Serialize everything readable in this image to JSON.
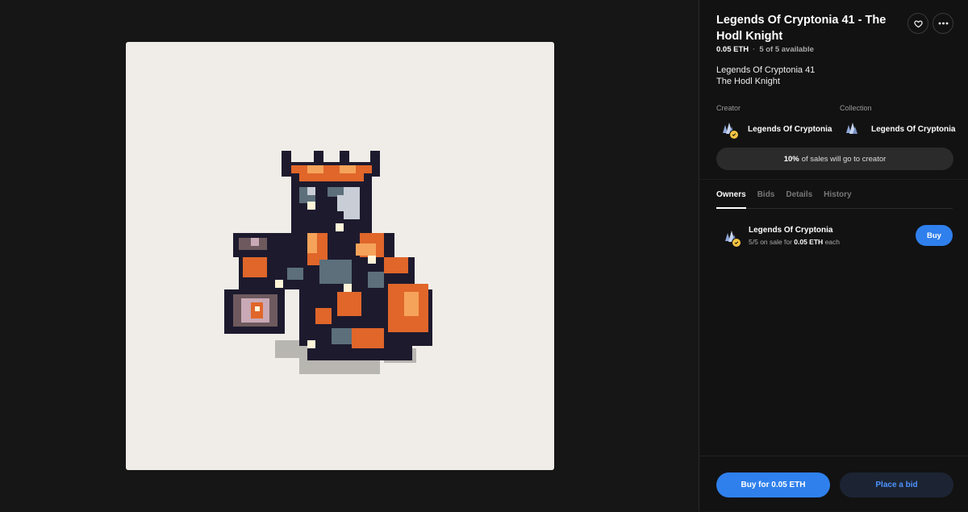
{
  "nft": {
    "title": "Legends Of Cryptonia 41 - The Hodl Knight",
    "price": "0.05 ETH",
    "availability": "5 of 5 available",
    "description_line1": "Legends Of Cryptonia 41",
    "description_line2": "The Hodl Knight"
  },
  "creator": {
    "label": "Creator",
    "name": "Legends Of Cryptonia"
  },
  "collection": {
    "label": "Collection",
    "name": "Legends Of Cryptonia"
  },
  "royalty": {
    "percent": "10%",
    "text": "of sales will go to creator"
  },
  "tabs": {
    "owners": "Owners",
    "bids": "Bids",
    "details": "Details",
    "history": "History",
    "active": "Owners"
  },
  "owner": {
    "name": "Legends Of Cryptonia",
    "on_sale_count": "5/5",
    "on_sale_text_a": "on sale for",
    "on_sale_price": "0.05 ETH",
    "on_sale_text_b": "each",
    "buy_label": "Buy"
  },
  "footer": {
    "buy_label": "Buy for 0.05 ETH",
    "bid_label": "Place a bid"
  },
  "icons": {
    "like": "heart-icon",
    "more": "more-horizontal-icon",
    "verified": "verified-check-icon"
  },
  "colors": {
    "accent": "#2f80ed",
    "verified": "#f5c342",
    "art_background": "#f0ede8"
  }
}
